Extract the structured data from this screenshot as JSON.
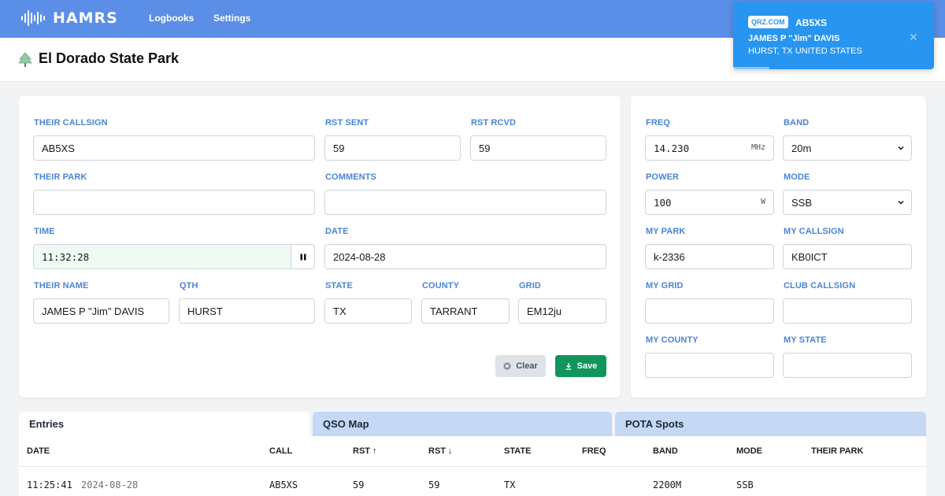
{
  "nav": {
    "app_name": "HAMRS",
    "links": [
      "Logbooks",
      "Settings"
    ]
  },
  "header": {
    "park_name": "El Dorado State Park"
  },
  "toast": {
    "badge": "QRZ.COM",
    "callsign": "AB5XS",
    "name": "JAMES P \"Jim\" DAVIS",
    "location": "HURST, TX UNITED STATES",
    "close_symbol": "✕"
  },
  "contact_form": {
    "their_callsign": {
      "label": "THEIR CALLSIGN",
      "value": "AB5XS"
    },
    "rst_sent": {
      "label": "RST SENT",
      "value": "59"
    },
    "rst_rcvd": {
      "label": "RST RCVD",
      "value": "59"
    },
    "their_park": {
      "label": "THEIR PARK",
      "value": ""
    },
    "comments": {
      "label": "COMMENTS",
      "value": ""
    },
    "time": {
      "label": "TIME",
      "value": "11:32:28"
    },
    "date": {
      "label": "DATE",
      "value": "2024-08-28"
    },
    "their_name": {
      "label": "THEIR NAME",
      "value": "JAMES P \"Jim\" DAVIS"
    },
    "qth": {
      "label": "QTH",
      "value": "HURST"
    },
    "state": {
      "label": "STATE",
      "value": "TX"
    },
    "county": {
      "label": "COUNTY",
      "value": "TARRANT"
    },
    "grid": {
      "label": "GRID",
      "value": "EM12ju"
    },
    "clear_label": "Clear",
    "save_label": "Save"
  },
  "station_form": {
    "freq": {
      "label": "FREQ",
      "value": "14.230",
      "unit": "MHz"
    },
    "band": {
      "label": "BAND",
      "value": "20m"
    },
    "power": {
      "label": "POWER",
      "value": "100",
      "unit": "W"
    },
    "mode": {
      "label": "MODE",
      "value": "SSB"
    },
    "my_park": {
      "label": "MY PARK",
      "value": "k-2336"
    },
    "my_callsign": {
      "label": "MY CALLSIGN",
      "value": "KB0ICT"
    },
    "my_grid": {
      "label": "MY GRID",
      "value": ""
    },
    "club_callsign": {
      "label": "CLUB CALLSIGN",
      "value": ""
    },
    "my_county": {
      "label": "MY COUNTY",
      "value": ""
    },
    "my_state": {
      "label": "MY STATE",
      "value": ""
    }
  },
  "tabs": [
    "Entries",
    "QSO Map",
    "POTA Spots"
  ],
  "table": {
    "headers": [
      "DATE",
      "CALL",
      "RST ↑",
      "RST ↓",
      "STATE",
      "FREQ",
      "BAND",
      "MODE",
      "THEIR PARK"
    ],
    "rows": [
      {
        "time": "11:25:41",
        "date": "2024-08-28",
        "call": "AB5XS",
        "rst_sent": "59",
        "rst_rcvd": "59",
        "state": "TX",
        "freq": "",
        "band": "2200M",
        "mode": "SSB",
        "their_park": ""
      }
    ]
  },
  "colors": {
    "nav_bg": "#5b8ee6",
    "label_blue": "#4a84d6",
    "toast_bg": "#2895f0",
    "save_green": "#12955d",
    "tab_inactive": "#c5d8f5"
  },
  "icons": [
    "waveform-logo-icon",
    "tree-icon",
    "pause-icon",
    "clear-x-icon",
    "download-icon",
    "chevron-down-icon",
    "close-icon"
  ]
}
